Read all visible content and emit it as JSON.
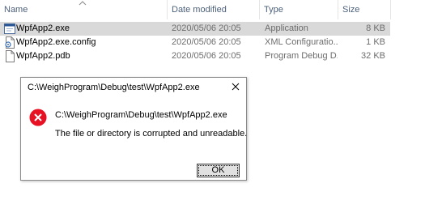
{
  "columns": {
    "name": "Name",
    "date": "Date modified",
    "type": "Type",
    "size": "Size"
  },
  "files": [
    {
      "name": "WpfApp2.exe",
      "date": "2020/05/06 20:05",
      "type": "Application",
      "size": "8 KB",
      "icon": "exe-file-icon",
      "selected": true
    },
    {
      "name": "WpfApp2.exe.config",
      "date": "2020/05/06 20:05",
      "type": "XML Configuratio...",
      "size": "1 KB",
      "icon": "config-file-icon",
      "selected": false
    },
    {
      "name": "WpfApp2.pdb",
      "date": "2020/05/06 20:05",
      "type": "Program Debug D...",
      "size": "32 KB",
      "icon": "blank-file-icon",
      "selected": false
    }
  ],
  "dialog": {
    "title": "C:\\WeighProgram\\Debug\\test\\WpfApp2.exe",
    "path": "C:\\WeighProgram\\Debug\\test\\WpfApp2.exe",
    "message": "The file or directory is corrupted and unreadable.",
    "ok_label": "OK"
  },
  "colors": {
    "selection": "#d9d9d9",
    "error": "#e81123",
    "header_text": "#4c607a"
  }
}
